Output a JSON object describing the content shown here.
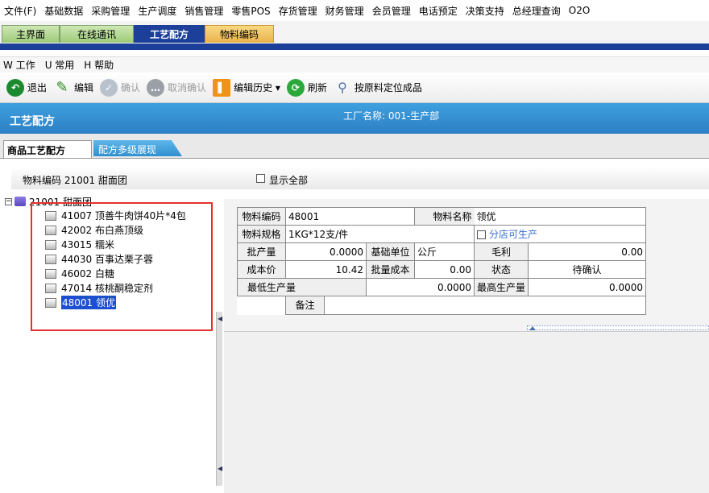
{
  "menu": [
    "文件(F)",
    "基础数据",
    "采购管理",
    "生产调度",
    "销售管理",
    "零售POS",
    "存货管理",
    "财务管理",
    "会员管理",
    "电话预定",
    "决策支持",
    "总经理查询",
    "O2O"
  ],
  "top_tabs": [
    "主界面",
    "在线通讯",
    "工艺配方",
    "物料编码"
  ],
  "sub_menu": [
    "W 工作",
    "U 常用",
    "H 帮助"
  ],
  "toolbar": {
    "exit": "退出",
    "edit": "编辑",
    "confirm": "确认",
    "cancel_confirm": "取消确认",
    "edit_history": "编辑历史 ▾",
    "refresh": "刷新",
    "locate": "按原料定位成品"
  },
  "header": {
    "title": "工艺配方",
    "factory": "工厂名称: 001-生产部"
  },
  "sub_tabs": [
    "商品工艺配方",
    "配方多级展现"
  ],
  "filter": {
    "material_code_label": "物料编码",
    "material_code_value": "21001 甜面团",
    "show_all": "显示全部"
  },
  "tree": {
    "root": "21001 甜面团",
    "items": [
      "41007 顶善牛肉饼40片*4包",
      "42002 布白燕顶级",
      "43015 糯米",
      "44030 百事达栗子蓉",
      "46002 白糖",
      "47014 核桃酮稳定剂",
      "48001 领优"
    ]
  },
  "form": {
    "code_label": "物料编码",
    "code_value": "48001",
    "name_label": "物料名称",
    "name_value": "领优",
    "spec_label": "物料规格",
    "spec_value": "1KG*12支/件",
    "branch_label": "分店可生产",
    "batch_label": "批产量",
    "batch_value": "0.0000",
    "unit_label": "基础单位",
    "unit_value": "公斤",
    "margin_label": "毛利",
    "margin_value": "0.00",
    "cost_label": "成本价",
    "cost_value": "10.42",
    "batch_cost_label": "批量成本",
    "batch_cost_value": "0.00",
    "status_label": "状态",
    "status_value": "待确认",
    "min_label": "最低生产量",
    "min_value": "0.0000",
    "max_label": "最高生产量",
    "max_value": "0.0000",
    "remark_label": "备注"
  }
}
